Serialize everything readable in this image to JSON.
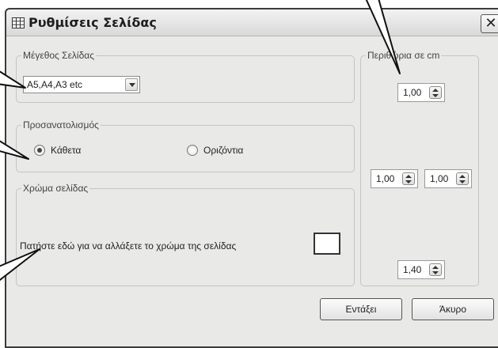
{
  "window": {
    "title": "Ρυθμίσεις Σελίδας",
    "title_icon": "grid-icon",
    "close_icon": "close-icon",
    "close_glyph": "✕"
  },
  "page_size": {
    "legend": "Μέγεθος Σελίδας",
    "selected": "A5,A4,A3 etc"
  },
  "orientation": {
    "legend": "Προσανατολισμός",
    "options": [
      {
        "label": "Κάθετα",
        "checked": true
      },
      {
        "label": "Οριζόντια",
        "checked": false
      }
    ]
  },
  "page_color": {
    "legend": "Χρώμα σελίδας",
    "instruction": "Πατήστε εδώ για να αλλάξετε το χρώμα της σελίδας",
    "color": "#ffffff"
  },
  "margins": {
    "legend": "Περιθώρια σε cm",
    "top": "1,00",
    "left": "1,00",
    "right": "1,00",
    "bottom": "1,40"
  },
  "buttons": {
    "ok": "Εντάξει",
    "cancel": "Άκυρο"
  }
}
